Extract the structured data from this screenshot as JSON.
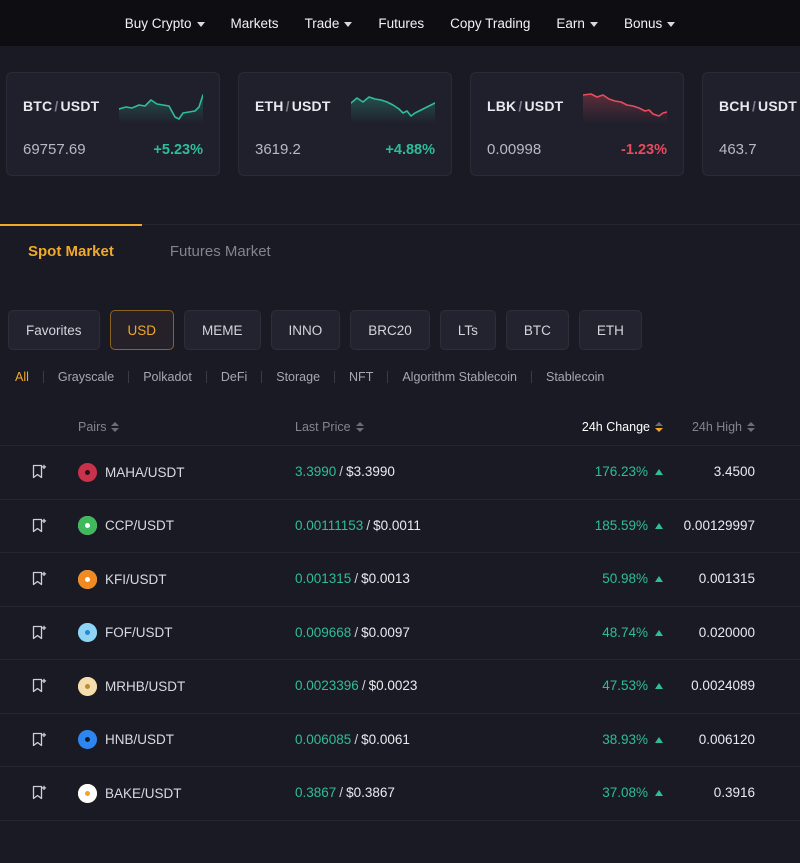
{
  "topnav": {
    "items": [
      {
        "label": "Buy Crypto",
        "caret": true
      },
      {
        "label": "Markets",
        "caret": false
      },
      {
        "label": "Trade",
        "caret": true
      },
      {
        "label": "Futures",
        "caret": false
      },
      {
        "label": "Copy Trading",
        "caret": false
      },
      {
        "label": "Earn",
        "caret": true
      },
      {
        "label": "Bonus",
        "caret": true
      }
    ]
  },
  "tickers": [
    {
      "base": "BTC",
      "quote": "USDT",
      "separator": "/",
      "price": "69757.69",
      "change": "+5.23%",
      "direction": "up",
      "color": "#2ebd9a",
      "spark": "0,20 7,18 13,19 20,16 26,17 32,11 38,15 44,16 50,17 56,28 60,30 64,24 70,23 76,22 80,18 84,6"
    },
    {
      "base": "ETH",
      "quote": "USDT",
      "separator": "/",
      "price": "3619.2",
      "change": "+4.88%",
      "direction": "up",
      "color": "#2ebd9a",
      "spark": "0,14 6,9 12,13 18,8 24,10 30,11 36,13 42,16 48,20 52,24 56,22 60,27 64,24 70,21 76,18 84,14"
    },
    {
      "base": "LBK",
      "quote": "USDT",
      "separator": "/",
      "price": "0.00998",
      "change": "-1.23%",
      "direction": "down",
      "color": "#e84b5d",
      "spark": "0,6 8,5 14,8 20,6 26,10 32,12 38,13 44,16 50,17 56,19 62,22 66,21 70,25 76,27 80,24 84,23"
    },
    {
      "base": "BCH",
      "quote": "USDT",
      "separator": "/",
      "price": "463.7",
      "change": "",
      "direction": "up",
      "color": "#2ebd9a",
      "spark": "0,18 8,16 16,17 24,14 32,15 40,12 48,13 56,10 64,11 72,8 80,6 84,5"
    }
  ],
  "market_tabs": [
    {
      "label": "Spot Market",
      "active": true
    },
    {
      "label": "Futures Market",
      "active": false
    }
  ],
  "chips": [
    {
      "label": "Favorites",
      "active": false
    },
    {
      "label": "USD",
      "active": true
    },
    {
      "label": "MEME",
      "active": false
    },
    {
      "label": "INNO",
      "active": false
    },
    {
      "label": "BRC20",
      "active": false
    },
    {
      "label": "LTs",
      "active": false
    },
    {
      "label": "BTC",
      "active": false
    },
    {
      "label": "ETH",
      "active": false
    }
  ],
  "subfilters": [
    {
      "label": "All",
      "active": true
    },
    {
      "label": "Grayscale",
      "active": false
    },
    {
      "label": "Polkadot",
      "active": false
    },
    {
      "label": "DeFi",
      "active": false
    },
    {
      "label": "Storage",
      "active": false
    },
    {
      "label": "NFT",
      "active": false
    },
    {
      "label": "Algorithm Stablecoin",
      "active": false
    },
    {
      "label": "Stablecoin",
      "active": false
    }
  ],
  "table": {
    "headers": [
      {
        "label": "Pairs",
        "active": false
      },
      {
        "label": "Last Price",
        "active": false
      },
      {
        "label": "24h Change",
        "active": true
      },
      {
        "label": "24h High",
        "active": false
      }
    ],
    "rows": [
      {
        "pair": "MAHA/USDT",
        "price": "3.3990",
        "separator": "/",
        "usd": "$3.3990",
        "change": "176.23%",
        "direction": "up",
        "high": "3.4500",
        "icon": {
          "name": "maha-coin-icon",
          "bg": "#2a0f16",
          "fg": "#c8324a"
        }
      },
      {
        "pair": "CCP/USDT",
        "price": "0.00111153",
        "separator": "/",
        "usd": "$0.0011",
        "change": "185.59%",
        "direction": "up",
        "high": "0.00129997",
        "icon": {
          "name": "ccp-coin-icon",
          "bg": "#ffffff",
          "fg": "#3fb95c"
        }
      },
      {
        "pair": "KFI/USDT",
        "price": "0.001315",
        "separator": "/",
        "usd": "$0.0013",
        "change": "50.98%",
        "direction": "up",
        "high": "0.001315",
        "icon": {
          "name": "kfi-coin-icon",
          "bg": "#ffffff",
          "fg": "#f08a22"
        }
      },
      {
        "pair": "FOF/USDT",
        "price": "0.009668",
        "separator": "/",
        "usd": "$0.0097",
        "change": "48.74%",
        "direction": "up",
        "high": "0.020000",
        "icon": {
          "name": "fof-coin-icon",
          "bg": "#2b86d4",
          "fg": "#8fd4f5"
        }
      },
      {
        "pair": "MRHB/USDT",
        "price": "0.0023396",
        "separator": "/",
        "usd": "$0.0023",
        "change": "47.53%",
        "direction": "up",
        "high": "0.0024089",
        "icon": {
          "name": "mrhb-coin-icon",
          "bg": "#c08a33",
          "fg": "#f5deae"
        }
      },
      {
        "pair": "HNB/USDT",
        "price": "0.006085",
        "separator": "/",
        "usd": "$0.0061",
        "change": "38.93%",
        "direction": "up",
        "high": "0.006120",
        "icon": {
          "name": "hnb-coin-icon",
          "bg": "#1a1a24",
          "fg": "#2e86f0"
        }
      },
      {
        "pair": "BAKE/USDT",
        "price": "0.3867",
        "separator": "/",
        "usd": "$0.3867",
        "change": "37.08%",
        "direction": "up",
        "high": "0.3916",
        "icon": {
          "name": "bake-coin-icon",
          "bg": "#f0a42a",
          "fg": "#ffffff"
        }
      }
    ]
  }
}
